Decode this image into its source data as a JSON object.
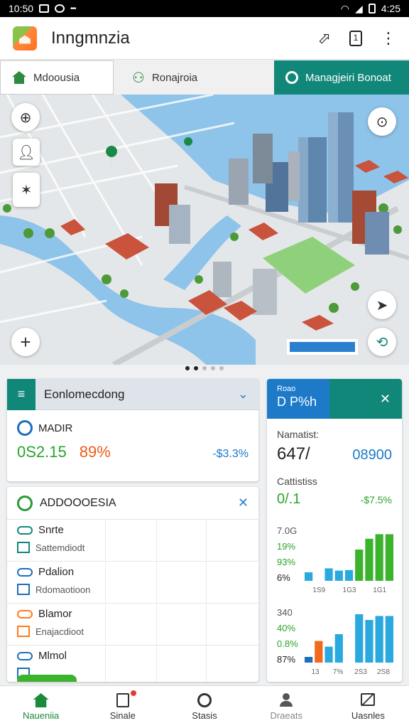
{
  "status_bar": {
    "time": "10:50",
    "battery_time": "4:25"
  },
  "app_bar": {
    "title": "Inngmnzia"
  },
  "tabs": [
    {
      "label": "Mdoousia"
    },
    {
      "label": "Ronajroia"
    },
    {
      "label": "Managjeiri Bonoat"
    }
  ],
  "map_label": "",
  "summary_card": {
    "header": "Eonlomecdong",
    "metric_label": "MADIR",
    "metric_value": "0S2.15",
    "metric_percent": "89%",
    "metric_delta": "-$3.3%"
  },
  "list_card": {
    "header": "ADDOOOESIA",
    "rows": [
      {
        "icon": "link-icon",
        "title": "Snrte",
        "subtitle": "Sattemdiodt",
        "color": "#11877a"
      },
      {
        "icon": "scale-icon",
        "title": "Pdalion",
        "subtitle": "Rdomaotioon",
        "color": "#1c6fb8"
      },
      {
        "icon": "glasses-icon",
        "title": "Blamor",
        "subtitle": "Enajacdioot",
        "color": "#ff7a1a"
      },
      {
        "icon": "link-icon",
        "title": "Mlmol",
        "subtitle": "",
        "color": "#1c6fb8"
      }
    ]
  },
  "stats_card": {
    "header_small": "Roao",
    "header_big": "D P%h",
    "label1": "Namatist:",
    "value1": "647/",
    "value1_alt": "08900",
    "label2": "Cattistiss",
    "value2": "0/.1",
    "value2_delta": "-$7.5%"
  },
  "chart_data": [
    {
      "type": "bar",
      "y_labels": [
        "7.0G",
        "19%",
        "93%",
        "6%"
      ],
      "x_labels": [
        "1S9",
        "1G3",
        "1G1"
      ],
      "series": [
        {
          "color": "#2aa9df",
          "values": [
            0.15,
            0.0,
            0.22,
            0.18,
            0.19,
            0.0,
            0.0,
            0.0,
            0.0
          ]
        },
        {
          "color": "#3cb32d",
          "values": [
            0.0,
            0.0,
            0.0,
            0.0,
            0.0,
            0.55,
            0.74,
            0.82,
            0.82
          ]
        }
      ]
    },
    {
      "type": "bar",
      "y_labels": [
        "340",
        "40%",
        "0.8%",
        "87%"
      ],
      "x_labels": [
        "13",
        "7%",
        "2S3",
        "2S8"
      ],
      "series": [
        {
          "color": "#1c6fb8",
          "values": [
            0.1,
            0.0,
            0.0,
            0.0,
            0.0,
            0.0,
            0.0,
            0.0,
            0.0
          ]
        },
        {
          "color": "#f26a1b",
          "values": [
            0.0,
            0.38,
            0.0,
            0.0,
            0.0,
            0.0,
            0.0,
            0.0,
            0.0
          ]
        },
        {
          "color": "#2aa9df",
          "values": [
            0.0,
            0.0,
            0.28,
            0.5,
            0.0,
            0.85,
            0.75,
            0.82,
            0.82
          ]
        }
      ]
    }
  ],
  "nav": [
    {
      "label": "Naueniia",
      "icon": "home-icon"
    },
    {
      "label": "Sinale",
      "icon": "document-icon"
    },
    {
      "label": "Stasis",
      "icon": "circle-icon"
    },
    {
      "label": "Draeats",
      "icon": "person-icon"
    },
    {
      "label": "Uasnles",
      "icon": "chart-icon"
    }
  ]
}
